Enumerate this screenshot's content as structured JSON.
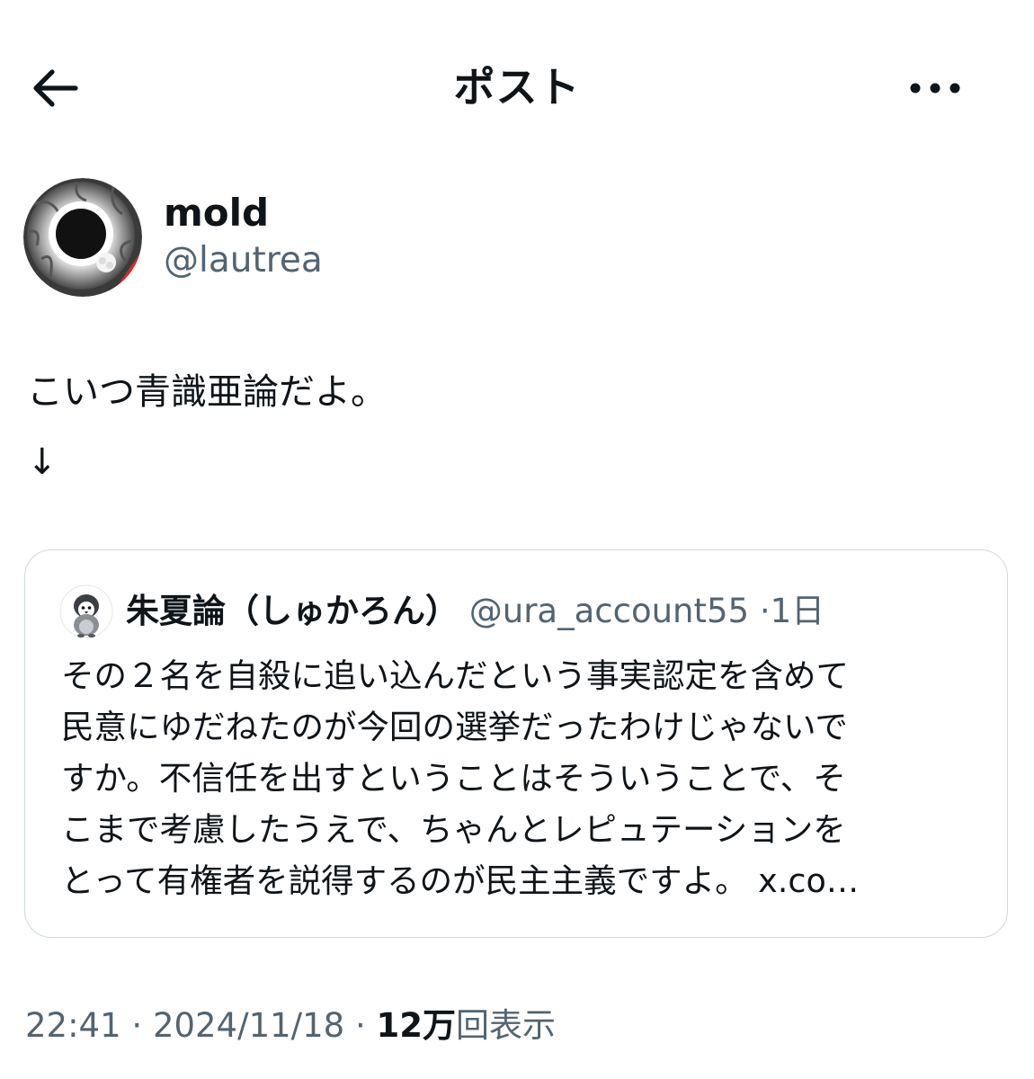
{
  "header": {
    "title": "ポスト",
    "back_icon": "arrow-left-icon",
    "more_icon": "more-horizontal-icon"
  },
  "author": {
    "name": "mold",
    "handle": "@lautrea"
  },
  "post": {
    "text": "こいつ青識亜論だよ。",
    "arrow": "↓"
  },
  "quote": {
    "avatar_icon": "penguin-avatar-icon",
    "name": "朱夏論（しゅかろん）",
    "handle": "@ura_account55",
    "separator": "·",
    "time": "1日",
    "lines": [
      "その２名を自殺に追い込んだという事実認定を含めて",
      "民意にゆだねたのが今回の選挙だったわけじゃないで",
      "すか。不信任を出すということはそういうことで、そ",
      "こまで考慮したうえで、ちゃんとレピュテーションを",
      "とって有権者を説得するのが民主主義ですよ。 x.co…"
    ]
  },
  "meta": {
    "time": "22:41",
    "separator": "·",
    "date": "2024/11/18",
    "views_count": "12万",
    "views_label": "回表示"
  },
  "colors": {
    "text_primary": "#0f1419",
    "text_secondary": "#536471",
    "border": "#cfd9de",
    "background": "#ffffff"
  }
}
